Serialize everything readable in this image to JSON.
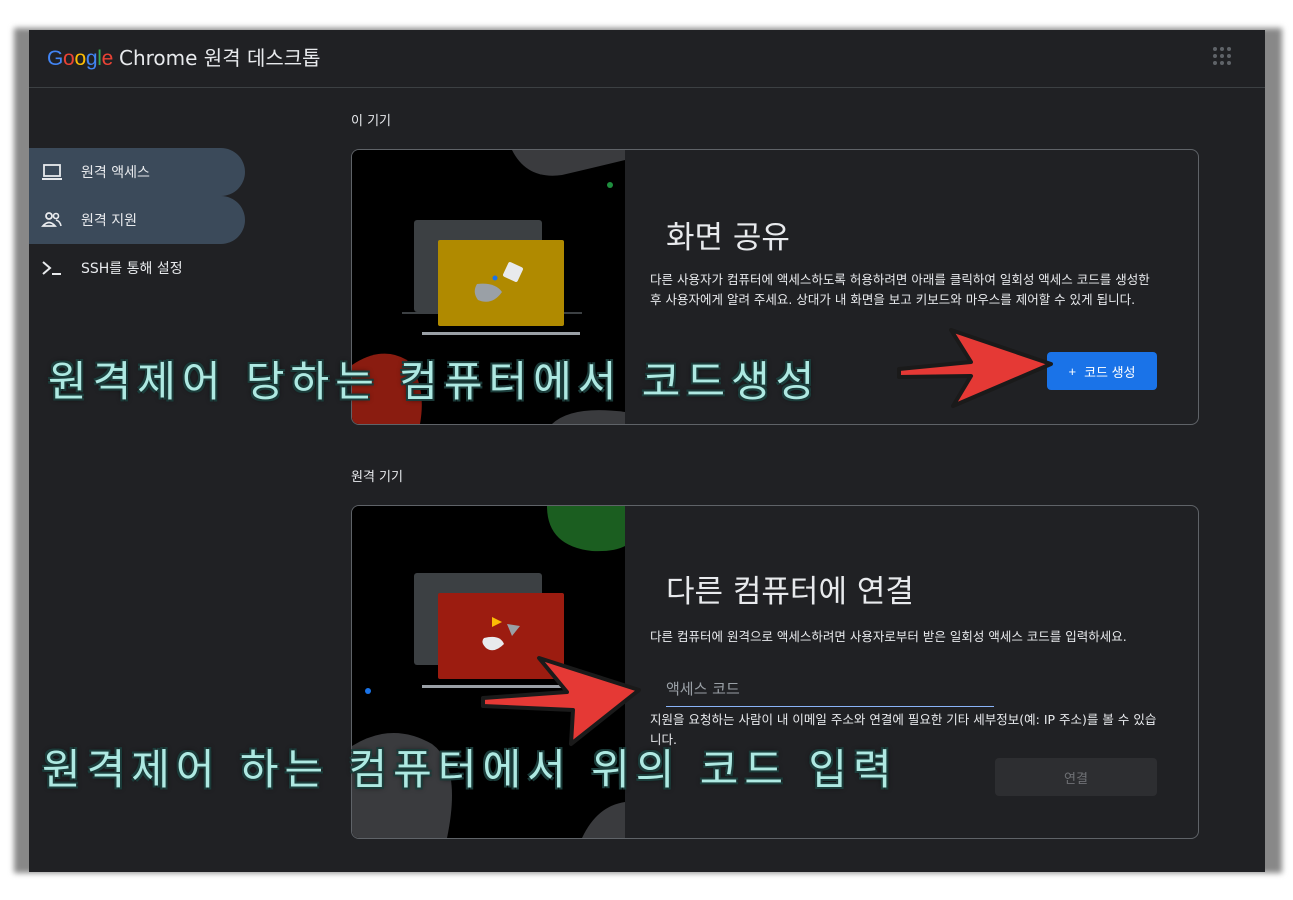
{
  "app": {
    "logo_google": "Google",
    "logo_product": "Chrome 원격 데스크톱",
    "apps_icon": "apps-grid-icon"
  },
  "sidebar": {
    "items": [
      {
        "label": "원격 액세스",
        "icon": "laptop-icon",
        "active": true
      },
      {
        "label": "원격 지원",
        "icon": "people-icon",
        "active": true
      },
      {
        "label": "SSH를 통해 설정",
        "icon": "terminal-icon",
        "active": false
      }
    ]
  },
  "sections": {
    "this_device": "이 기기",
    "remote_device": "원격 기기"
  },
  "share_card": {
    "title": "화면 공유",
    "description": "다른 사용자가 컴퓨터에 액세스하도록 허용하려면 아래를 클릭하여 일회성 액세스 코드를 생성한 후 사용자에게 알려 주세요. 상대가 내 화면을 보고 키보드와 마우스를 제어할 수 있게 됩니다.",
    "button_label": "코드 생성",
    "button_icon": "+"
  },
  "connect_card": {
    "title": "다른 컴퓨터에 연결",
    "description": "다른 컴퓨터에 원격으로 액세스하려면 사용자로부터 받은 일회성 액세스 코드를 입력하세요.",
    "input_placeholder": "액세스 코드",
    "helper_text": "지원을 요청하는 사람이 내 이메일 주소와 연결에 필요한 기타 세부정보(예: IP 주소)를 볼 수 있습니다.",
    "button_label": "연결"
  },
  "annotations": {
    "top": "원격제어 당하는 컴퓨터에서 코드생성",
    "bottom": "원격제어 하는 컴퓨터에서 위의 코드 입력"
  },
  "colors": {
    "background": "#202124",
    "primary_button": "#1a73e8",
    "active_nav": "#3b4a5a",
    "arrow": "#e53935",
    "overlay_text": "#aee9e2"
  }
}
